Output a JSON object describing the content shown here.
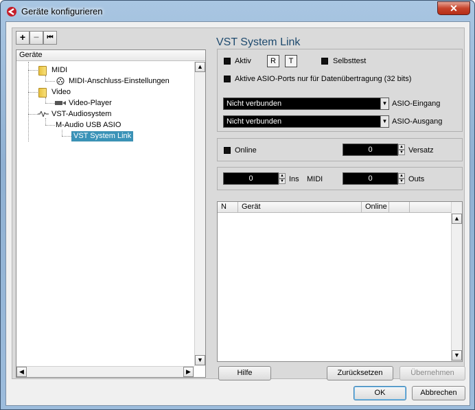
{
  "window": {
    "title": "Geräte konfigurieren",
    "close_label": "✕"
  },
  "toolbar": {
    "add_label": "+",
    "remove_label": "−",
    "reset_label": "⏮"
  },
  "tree": {
    "header": "Geräte",
    "nodes": [
      {
        "label": "MIDI",
        "icon": "folder-icon"
      },
      {
        "label": "MIDI-Anschluss-Einstellungen",
        "icon": "midi-port-icon"
      },
      {
        "label": "Video",
        "icon": "folder-icon"
      },
      {
        "label": "Video-Player",
        "icon": "video-player-icon"
      },
      {
        "label": "VST-Audiosystem",
        "icon": "audio-system-icon"
      },
      {
        "label": "M-Audio USB ASIO"
      },
      {
        "label": "VST System Link"
      }
    ]
  },
  "panel": {
    "title": "VST System Link",
    "aktiv_label": "Aktiv",
    "r_label": "R",
    "t_label": "T",
    "selbsttest_label": "Selbsttest",
    "asio_ports_label": "Aktive ASIO-Ports nur für Datenübertragung (32 bits)",
    "asio_in_value": "Nicht verbunden",
    "asio_in_label": "ASIO-Eingang",
    "asio_out_value": "Nicht verbunden",
    "asio_out_label": "ASIO-Ausgang",
    "online_label": "Online",
    "versatz_value": "0",
    "versatz_label": "Versatz",
    "ins_value": "0",
    "ins_label": "Ins",
    "midi_label": "MIDI",
    "outs_value": "0",
    "outs_label": "Outs",
    "table_headers": [
      "N",
      "Gerät",
      "Online"
    ],
    "hilfe_label": "Hilfe",
    "zuruecksetzen_label": "Zurücksetzen",
    "uebernehmen_label": "Übernehmen"
  },
  "footer": {
    "ok_label": "OK",
    "abbrechen_label": "Abbrechen"
  },
  "colors": {
    "accent": "#1e4a6e",
    "selection": "#3a93b8",
    "close": "#c7442c"
  }
}
